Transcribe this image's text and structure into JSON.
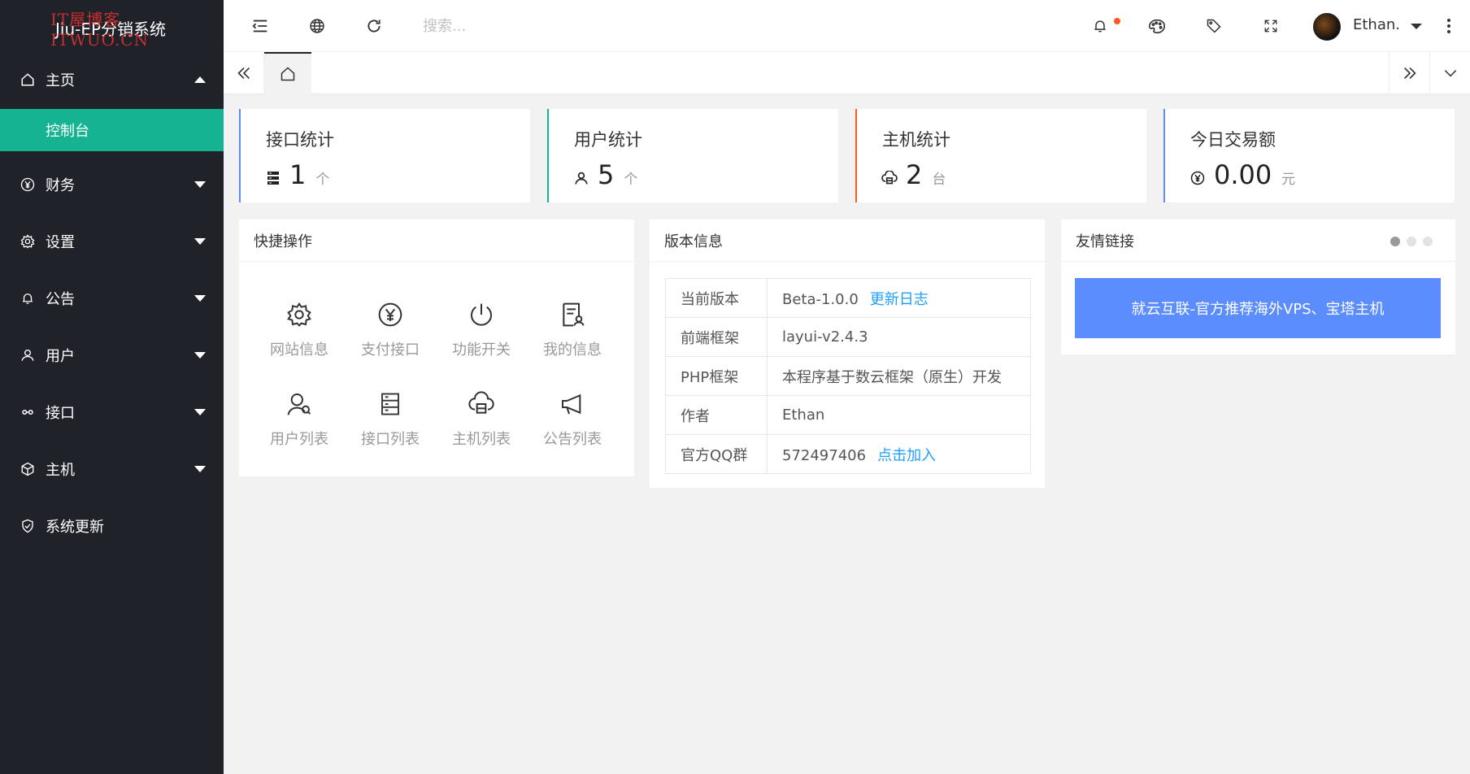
{
  "sidebar": {
    "logo": "Jiu-EP分销系统",
    "watermark": "IT屋博客 ITWUO.CN",
    "home": "主页",
    "home_sub": "控制台",
    "items": [
      {
        "label": "财务",
        "icon": "yen-circle-icon"
      },
      {
        "label": "设置",
        "icon": "gear-icon"
      },
      {
        "label": "公告",
        "icon": "bell-icon"
      },
      {
        "label": "用户",
        "icon": "user-icon"
      },
      {
        "label": "接口",
        "icon": "link-icon"
      },
      {
        "label": "主机",
        "icon": "cube-icon"
      },
      {
        "label": "系统更新",
        "icon": "shield-check-icon"
      }
    ]
  },
  "header": {
    "search_placeholder": "搜索...",
    "username": "Ethan.",
    "notification_dot_color": "#ff5722"
  },
  "stats": [
    {
      "title": "接口统计",
      "value": "1",
      "unit": "个",
      "color": "#5c8dff",
      "icon": "server-icon"
    },
    {
      "title": "用户统计",
      "value": "5",
      "unit": "个",
      "color": "#16b393",
      "icon": "user-icon"
    },
    {
      "title": "主机统计",
      "value": "2",
      "unit": "台",
      "color": "#ff5722",
      "icon": "cloud-icon"
    },
    {
      "title": "今日交易额",
      "value": "0.00",
      "unit": "元",
      "color": "#5c8dff",
      "icon": "yen-circle-icon"
    }
  ],
  "quick": {
    "title": "快捷操作",
    "items": [
      "网站信息",
      "支付接口",
      "功能开关",
      "我的信息",
      "用户列表",
      "接口列表",
      "主机列表",
      "公告列表"
    ]
  },
  "version": {
    "title": "版本信息",
    "rows": [
      {
        "k": "当前版本",
        "v": "Beta-1.0.0",
        "link": "更新日志"
      },
      {
        "k": "前端框架",
        "v": "layui-v2.4.3",
        "link": ""
      },
      {
        "k": "PHP框架",
        "v": "本程序基于数云框架（原生）开发",
        "link": ""
      },
      {
        "k": "作者",
        "v": "Ethan",
        "link": ""
      },
      {
        "k": "官方QQ群",
        "v": "572497406",
        "link": "点击加入"
      }
    ]
  },
  "links": {
    "title": "友情链接",
    "banner": "就云互联-官方推荐海外VPS、宝塔主机",
    "banner_color": "#5c8dff"
  },
  "colors": {
    "sidebar_bg": "#20222a",
    "accent_green": "#16b393",
    "link_blue": "#1e9fff"
  }
}
